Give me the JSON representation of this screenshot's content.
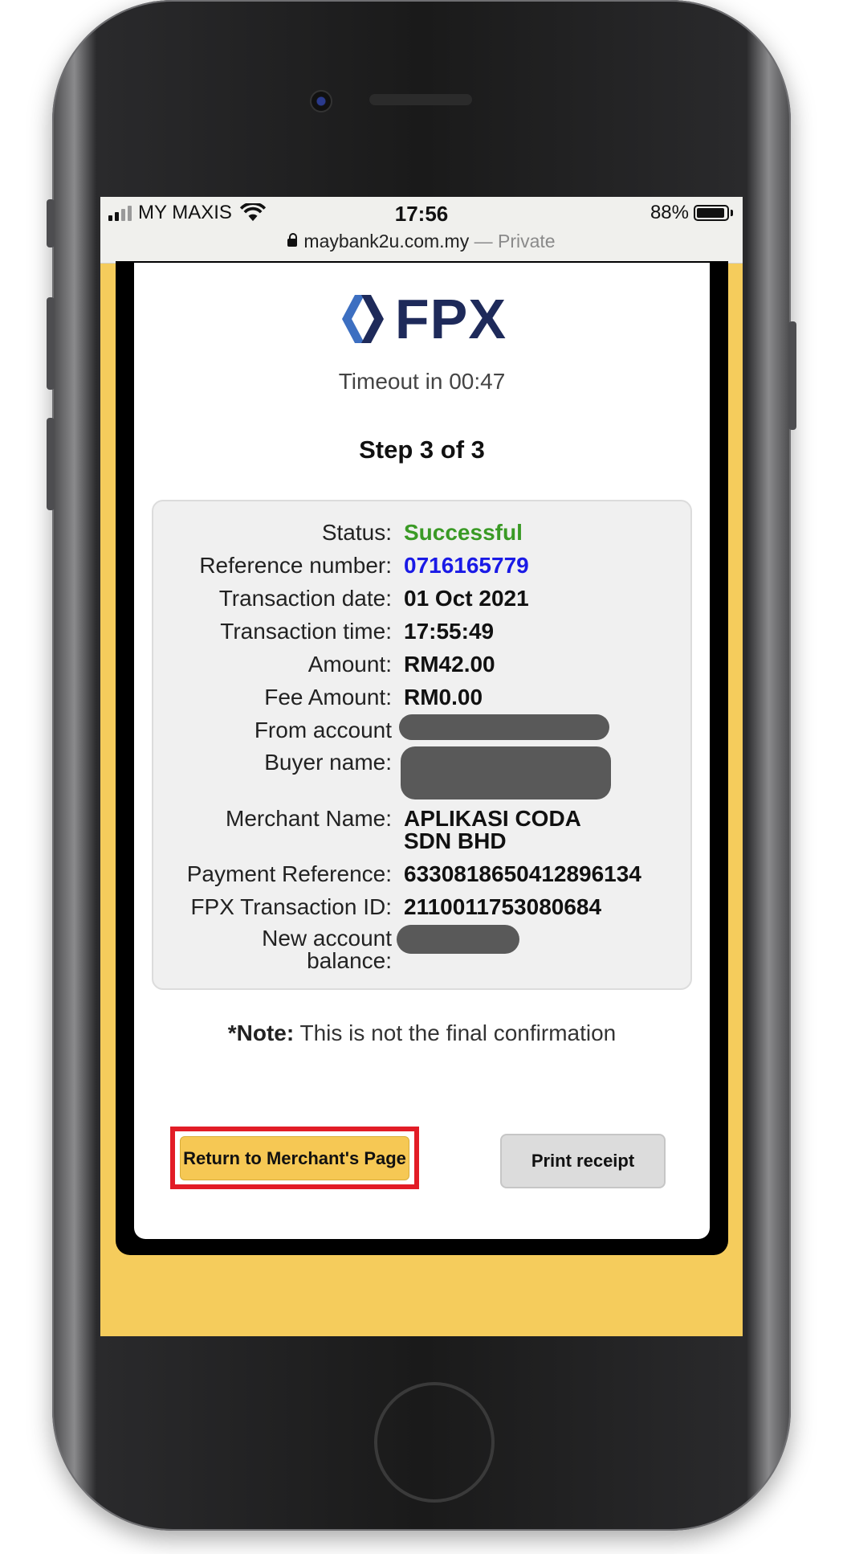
{
  "statusbar": {
    "carrier": "MY MAXIS",
    "time": "17:56",
    "battery": "88%",
    "url": "maybank2u.com.my",
    "private_label": " — Private"
  },
  "page": {
    "logo_text": "FPX",
    "timeout": "Timeout in 00:47",
    "step": "Step 3 of 3"
  },
  "details": {
    "status_label": "Status:",
    "status_value": "Successful",
    "reference_label": "Reference number:",
    "reference_value": "0716165779",
    "date_label": "Transaction date:",
    "date_value": "01 Oct 2021",
    "time_label": "Transaction time:",
    "time_value": "17:55:49",
    "amount_label": "Amount:",
    "amount_value": "RM42.00",
    "fee_label": "Fee Amount:",
    "fee_value": "RM0.00",
    "from_label": "From account",
    "buyer_label": "Buyer name:",
    "merchant_label": "Merchant Name:",
    "merchant_value": "APLIKASI CODA SDN BHD",
    "payref_label": "Payment Reference:",
    "payref_value": "6330818650412896134",
    "fpxid_label": "FPX Transaction ID:",
    "fpxid_value": "2110011753080684",
    "balance_label": "New account balance:"
  },
  "note": {
    "bold": "*Note:",
    "text": " This is not the final confirmation"
  },
  "buttons": {
    "return": "Return to Merchant's Page",
    "print": "Print receipt"
  },
  "colors": {
    "accent": "#f6c854",
    "success": "#3a9a25",
    "link": "#1a1ae6",
    "highlight": "#e21c26"
  }
}
